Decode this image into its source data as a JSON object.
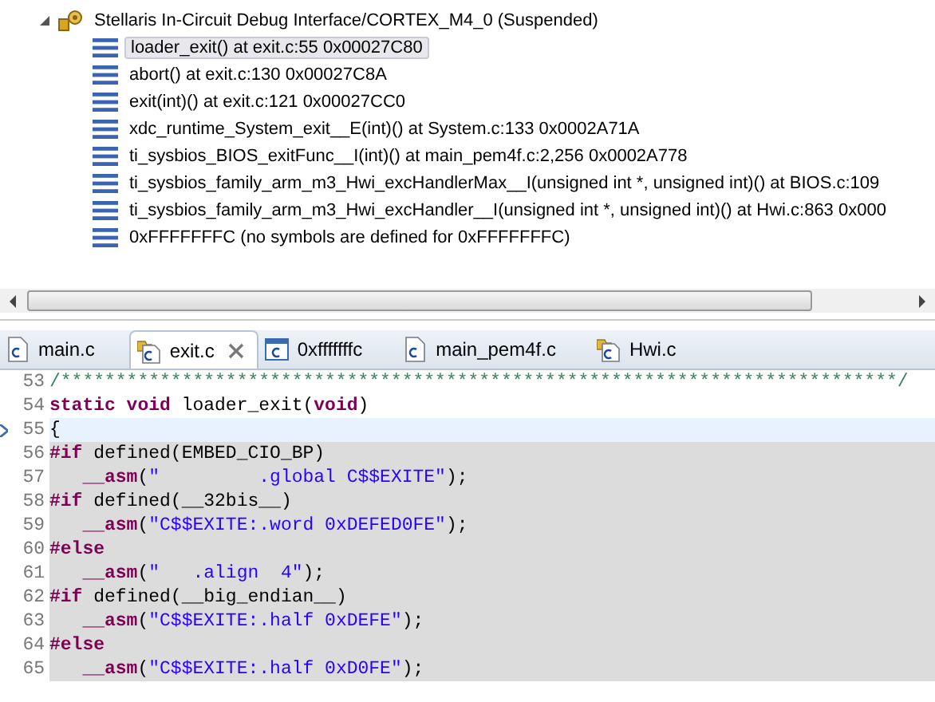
{
  "debug_tree": {
    "root": {
      "label": "Stellaris In-Circuit Debug Interface/CORTEX_M4_0 (Suspended)",
      "expanded": true,
      "children": [
        {
          "label": "loader_exit() at exit.c:55 0x00027C80",
          "selected": true
        },
        {
          "label": "abort() at exit.c:130 0x00027C8A",
          "selected": false
        },
        {
          "label": "exit(int)() at exit.c:121 0x00027CC0",
          "selected": false
        },
        {
          "label": "xdc_runtime_System_exit__E(int)() at System.c:133 0x0002A71A",
          "selected": false
        },
        {
          "label": "ti_sysbios_BIOS_exitFunc__I(int)() at main_pem4f.c:2,256 0x0002A778",
          "selected": false
        },
        {
          "label": "ti_sysbios_family_arm_m3_Hwi_excHandlerMax__I(unsigned int *, unsigned int)() at BIOS.c:109",
          "selected": false
        },
        {
          "label": "ti_sysbios_family_arm_m3_Hwi_excHandler__I(unsigned int *, unsigned int)() at Hwi.c:863 0x000",
          "selected": false
        },
        {
          "label": "0xFFFFFFFC  (no symbols are defined for 0xFFFFFFFC)",
          "selected": false
        }
      ]
    }
  },
  "tabs": [
    {
      "label": "main.c",
      "kind": "plain",
      "selected": false
    },
    {
      "label": "exit.c",
      "kind": "folder",
      "selected": true
    },
    {
      "label": "0xfffffffc",
      "kind": "frame",
      "selected": false
    },
    {
      "label": "main_pem4f.c",
      "kind": "plain",
      "selected": false
    },
    {
      "label": "Hwi.c",
      "kind": "folder",
      "selected": false
    }
  ],
  "editor": {
    "lines": [
      {
        "number": "53",
        "current": false,
        "inactive": false,
        "tokens": [
          {
            "kind": "comment",
            "text": "/****************************************************************************/"
          }
        ]
      },
      {
        "number": "54",
        "current": false,
        "inactive": false,
        "tokens": [
          {
            "kind": "keyword",
            "text": "static void"
          },
          {
            "kind": "plain",
            "text": " loader_exit("
          },
          {
            "kind": "keyword",
            "text": "void"
          },
          {
            "kind": "plain",
            "text": ")"
          }
        ]
      },
      {
        "number": "55",
        "current": true,
        "inactive": false,
        "tokens": [
          {
            "kind": "plain",
            "text": "{"
          }
        ]
      },
      {
        "number": "56",
        "current": false,
        "inactive": true,
        "tokens": [
          {
            "kind": "keyword",
            "text": "#if"
          },
          {
            "kind": "plain",
            "text": " defined(EMBED_CIO_BP)"
          }
        ]
      },
      {
        "number": "57",
        "current": false,
        "inactive": true,
        "tokens": [
          {
            "kind": "keyword",
            "text": "   __asm"
          },
          {
            "kind": "plain",
            "text": "("
          },
          {
            "kind": "string",
            "text": "\"         .global C$$EXITE\""
          },
          {
            "kind": "plain",
            "text": ");"
          }
        ]
      },
      {
        "number": "58",
        "current": false,
        "inactive": true,
        "tokens": [
          {
            "kind": "keyword",
            "text": "#if"
          },
          {
            "kind": "plain",
            "text": " defined(__32bis__)"
          }
        ]
      },
      {
        "number": "59",
        "current": false,
        "inactive": true,
        "tokens": [
          {
            "kind": "keyword",
            "text": "   __asm"
          },
          {
            "kind": "plain",
            "text": "("
          },
          {
            "kind": "string",
            "text": "\"C$$EXITE:.word 0xDEFED0FE\""
          },
          {
            "kind": "plain",
            "text": ");"
          }
        ]
      },
      {
        "number": "60",
        "current": false,
        "inactive": true,
        "tokens": [
          {
            "kind": "keyword",
            "text": "#else"
          }
        ]
      },
      {
        "number": "61",
        "current": false,
        "inactive": true,
        "tokens": [
          {
            "kind": "keyword",
            "text": "   __asm"
          },
          {
            "kind": "plain",
            "text": "("
          },
          {
            "kind": "string",
            "text": "\"   .align  4\""
          },
          {
            "kind": "plain",
            "text": ");"
          }
        ]
      },
      {
        "number": "62",
        "current": false,
        "inactive": true,
        "tokens": [
          {
            "kind": "keyword",
            "text": "#if"
          },
          {
            "kind": "plain",
            "text": " defined(__big_endian__)"
          }
        ]
      },
      {
        "number": "63",
        "current": false,
        "inactive": true,
        "tokens": [
          {
            "kind": "keyword",
            "text": "   __asm"
          },
          {
            "kind": "plain",
            "text": "("
          },
          {
            "kind": "string",
            "text": "\"C$$EXITE:.half 0xDEFE\""
          },
          {
            "kind": "plain",
            "text": ");"
          }
        ]
      },
      {
        "number": "64",
        "current": false,
        "inactive": true,
        "tokens": [
          {
            "kind": "keyword",
            "text": "#else"
          }
        ]
      },
      {
        "number": "65",
        "current": false,
        "inactive": true,
        "tokens": [
          {
            "kind": "keyword",
            "text": "   __asm"
          },
          {
            "kind": "plain",
            "text": "("
          },
          {
            "kind": "string",
            "text": "\"C$$EXITE:.half 0xD0FE\""
          },
          {
            "kind": "plain",
            "text": ");"
          }
        ]
      }
    ]
  }
}
